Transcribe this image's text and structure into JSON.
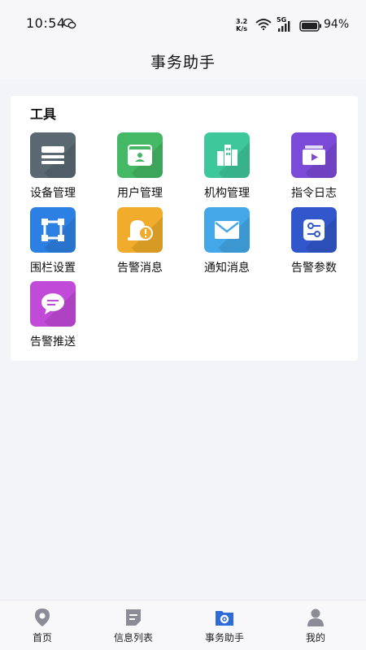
{
  "status_bar": {
    "time": "10:54",
    "net_speed_value": "3.2",
    "net_speed_unit": "K/s",
    "network": "5G",
    "battery": "94%"
  },
  "header": {
    "title": "事务助手"
  },
  "tools": {
    "section_title": "工具",
    "items": [
      {
        "label": "设备管理",
        "icon": "device-icon",
        "color": "#5a6872"
      },
      {
        "label": "用户管理",
        "icon": "user-card-icon",
        "color": "#45b865"
      },
      {
        "label": "机构管理",
        "icon": "building-icon",
        "color": "#3ec79a"
      },
      {
        "label": "指令日志",
        "icon": "video-log-icon",
        "color": "#7b4ad6"
      },
      {
        "label": "围栏设置",
        "icon": "fence-icon",
        "color": "#2d80e3"
      },
      {
        "label": "告警消息",
        "icon": "alarm-bell-icon",
        "color": "#f0ac2a"
      },
      {
        "label": "通知消息",
        "icon": "mail-icon",
        "color": "#43a7e8"
      },
      {
        "label": "告警参数",
        "icon": "sliders-icon",
        "color": "#3257cc"
      },
      {
        "label": "告警推送",
        "icon": "chat-bubble-icon",
        "color": "#c24ad9"
      }
    ]
  },
  "tabbar": {
    "active_color": "#2f6ad9",
    "items": [
      {
        "label": "首页",
        "icon": "map-pin-icon"
      },
      {
        "label": "信息列表",
        "icon": "note-icon"
      },
      {
        "label": "事务助手",
        "icon": "gear-folder-icon",
        "active": true
      },
      {
        "label": "我的",
        "icon": "person-icon"
      }
    ]
  }
}
